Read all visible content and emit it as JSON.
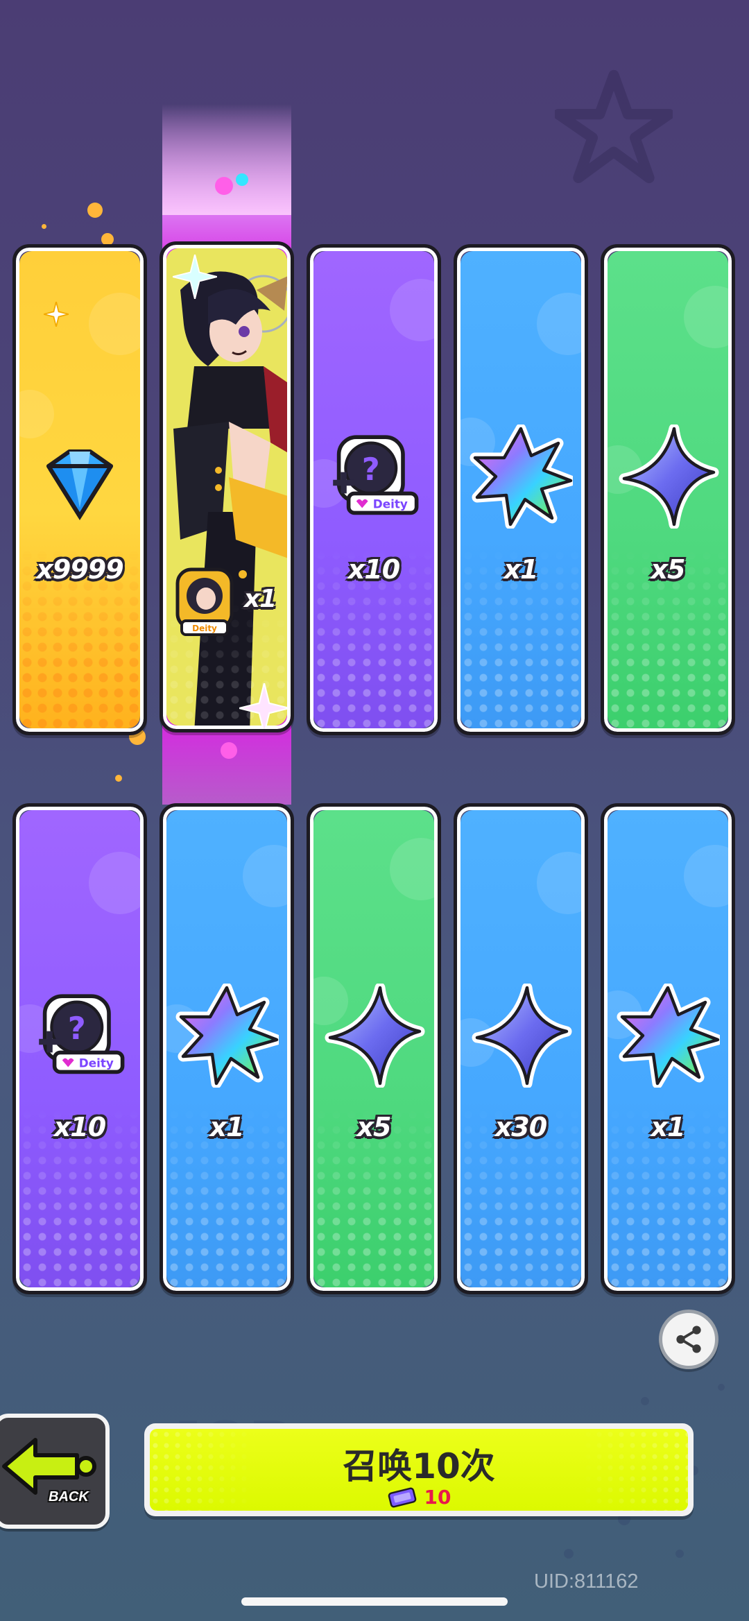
{
  "rewards": {
    "row1": [
      {
        "rarity": "gold",
        "item_icon": "diamond-icon",
        "quantity": "x9999"
      },
      {
        "rarity": "hero",
        "item_icon": "character-portrait",
        "quantity": "x1",
        "badge": "Deity"
      },
      {
        "rarity": "purple",
        "item_icon": "mystery-deity-token-icon",
        "quantity": "x10",
        "badge": "Deity"
      },
      {
        "rarity": "blue",
        "item_icon": "rainbow-star-icon",
        "quantity": "x1"
      },
      {
        "rarity": "green",
        "item_icon": "blue-star-icon",
        "quantity": "x5"
      }
    ],
    "row2": [
      {
        "rarity": "purple",
        "item_icon": "mystery-deity-token-icon",
        "quantity": "x10",
        "badge": "Deity"
      },
      {
        "rarity": "blue",
        "item_icon": "rainbow-star-icon",
        "quantity": "x1"
      },
      {
        "rarity": "green",
        "item_icon": "blue-star-icon",
        "quantity": "x5"
      },
      {
        "rarity": "blue",
        "item_icon": "blue-star-icon",
        "quantity": "x30"
      },
      {
        "rarity": "blue",
        "item_icon": "rainbow-star-icon",
        "quantity": "x1"
      }
    ]
  },
  "controls": {
    "back_label": "BACK",
    "summon_label": "召唤10次",
    "summon_cost": "10",
    "summon_cost_icon": "summon-ticket-icon",
    "share_icon": "share-icon"
  },
  "footer": {
    "uid": "UID:811162"
  },
  "colors": {
    "gold": "#ffd23e",
    "purple": "#9562ff",
    "blue": "#47a9ff",
    "green": "#52db80",
    "summon_button": "#e6ff0e",
    "cost_text": "#e8184c"
  }
}
